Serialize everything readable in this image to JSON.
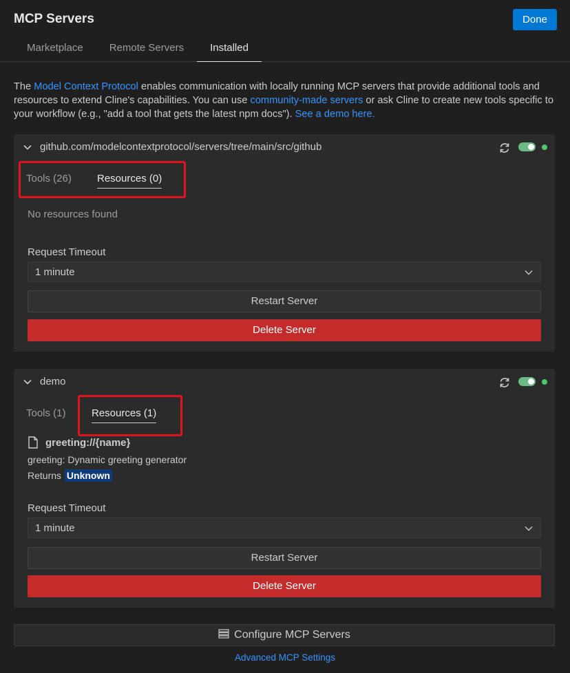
{
  "header": {
    "title": "MCP Servers",
    "done_label": "Done",
    "tabs": [
      "Marketplace",
      "Remote Servers",
      "Installed"
    ],
    "active_tab": "Installed"
  },
  "intro": {
    "t1": "The ",
    "link1": "Model Context Protocol",
    "t2": " enables communication with locally running MCP servers that provide additional tools and resources to extend Cline's capabilities. You can use ",
    "link2": "community-made servers",
    "t3": " or ask Cline to create new tools specific to your workflow (e.g., \"add a tool that gets the latest npm docs\"). ",
    "link3": "See a demo here."
  },
  "servers": [
    {
      "name": "github.com/modelcontextprotocol/servers/tree/main/src/github",
      "tools_tab": "Tools (26)",
      "resources_tab": "Resources (0)",
      "empty_message": "No resources found",
      "timeout_label": "Request Timeout",
      "timeout_value": "1 minute",
      "restart_label": "Restart Server",
      "delete_label": "Delete Server",
      "enabled": true,
      "status_color": "#4ec969"
    },
    {
      "name": "demo",
      "tools_tab": "Tools (1)",
      "resources_tab": "Resources (1)",
      "resource": {
        "uri": "greeting://{name}",
        "description": "greeting: Dynamic greeting generator",
        "returns_label": "Returns",
        "returns_type": "Unknown"
      },
      "timeout_label": "Request Timeout",
      "timeout_value": "1 minute",
      "restart_label": "Restart Server",
      "delete_label": "Delete Server",
      "enabled": true,
      "status_color": "#4ec969"
    }
  ],
  "footer": {
    "configure_label": "Configure MCP Servers",
    "advanced_label": "Advanced MCP Settings"
  },
  "icons": {
    "collapse": "chevron-down-icon",
    "refresh": "refresh-icon",
    "resource": "file-icon",
    "configure": "server-icon"
  },
  "colors": {
    "accent": "#0078d4",
    "link": "#3794ff",
    "delete": "#c42b2b",
    "toggle_on": "#6dba84",
    "highlight_box": "#e0141e"
  }
}
